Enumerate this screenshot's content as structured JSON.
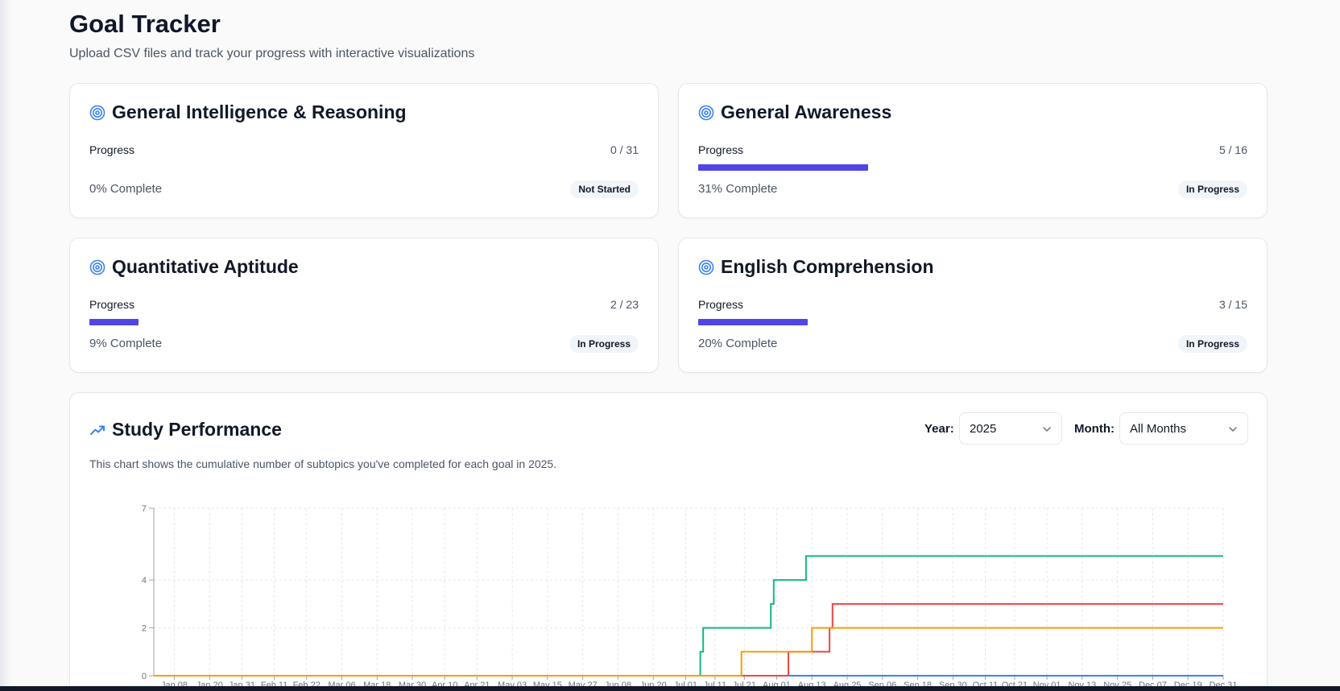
{
  "header": {
    "title": "Goal Tracker",
    "subtitle": "Upload CSV files and track your progress with interactive visualizations"
  },
  "goals": [
    {
      "title": "General Intelligence & Reasoning",
      "progress_label": "Progress",
      "count": "0 / 31",
      "percent": 0,
      "complete_text": "0% Complete",
      "status": "Not Started"
    },
    {
      "title": "General Awareness",
      "progress_label": "Progress",
      "count": "5 / 16",
      "percent": 31,
      "complete_text": "31% Complete",
      "status": "In Progress"
    },
    {
      "title": "Quantitative Aptitude",
      "progress_label": "Progress",
      "count": "2 / 23",
      "percent": 9,
      "complete_text": "9% Complete",
      "status": "In Progress"
    },
    {
      "title": "English Comprehension",
      "progress_label": "Progress",
      "count": "3 / 15",
      "percent": 20,
      "complete_text": "20% Complete",
      "status": "In Progress"
    }
  ],
  "performance": {
    "title": "Study Performance",
    "description": "This chart shows the cumulative number of subtopics you've completed for each goal in 2025.",
    "year_label": "Year:",
    "year_value": "2025",
    "month_label": "Month:",
    "month_value": "All Months"
  },
  "colors": {
    "accent": "#4f46e5",
    "icon_blue": "#3b82f6",
    "series_green": "#10b981",
    "series_red": "#ef4444",
    "series_orange": "#f59e0b",
    "series_blue": "#3b82f6"
  },
  "chart_data": {
    "type": "line",
    "step": true,
    "x_ticks": [
      "Jan 08",
      "Jan 20",
      "Jan 31",
      "Feb 11",
      "Feb 22",
      "Mar 06",
      "Mar 18",
      "Mar 30",
      "Apr 10",
      "Apr 21",
      "May 03",
      "May 15",
      "May 27",
      "Jun 08",
      "Jun 20",
      "Jul 01",
      "Jul 11",
      "Jul 21",
      "Aug 01",
      "Aug 13",
      "Aug 25",
      "Sep 06",
      "Sep 18",
      "Sep 30",
      "Oct 11",
      "Oct 21",
      "Nov 01",
      "Nov 13",
      "Nov 25",
      "Dec 07",
      "Dec 19",
      "Dec 31"
    ],
    "y_ticks": [
      0,
      2,
      4,
      7
    ],
    "xlim": [
      "2025-01-01",
      "2025-12-31"
    ],
    "ylim": [
      0,
      7
    ],
    "grid": true,
    "series": [
      {
        "color": "#10b981",
        "points": [
          [
            "2025-01-01",
            0
          ],
          [
            "2025-07-06",
            0
          ],
          [
            "2025-07-06",
            1
          ],
          [
            "2025-07-07",
            1
          ],
          [
            "2025-07-07",
            2
          ],
          [
            "2025-07-30",
            2
          ],
          [
            "2025-07-30",
            3
          ],
          [
            "2025-07-31",
            3
          ],
          [
            "2025-07-31",
            4
          ],
          [
            "2025-08-11",
            4
          ],
          [
            "2025-08-11",
            5
          ],
          [
            "2025-12-31",
            5
          ]
        ]
      },
      {
        "color": "#ef4444",
        "points": [
          [
            "2025-01-01",
            0
          ],
          [
            "2025-08-05",
            0
          ],
          [
            "2025-08-05",
            1
          ],
          [
            "2025-08-19",
            1
          ],
          [
            "2025-08-19",
            2
          ],
          [
            "2025-08-20",
            2
          ],
          [
            "2025-08-20",
            3
          ],
          [
            "2025-12-31",
            3
          ]
        ]
      },
      {
        "color": "#f59e0b",
        "points": [
          [
            "2025-01-01",
            0
          ],
          [
            "2025-07-20",
            0
          ],
          [
            "2025-07-20",
            1
          ],
          [
            "2025-08-13",
            1
          ],
          [
            "2025-08-13",
            2
          ],
          [
            "2025-12-31",
            2
          ]
        ]
      },
      {
        "color": "#3b82f6",
        "points": [
          [
            "2025-08-05",
            0
          ],
          [
            "2025-12-31",
            0
          ]
        ]
      }
    ]
  }
}
